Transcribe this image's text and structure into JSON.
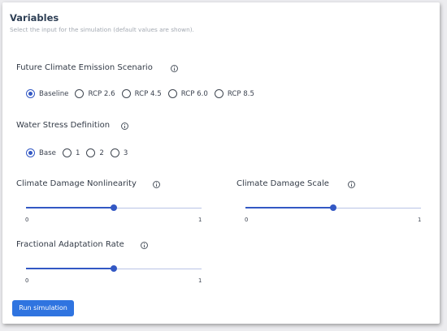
{
  "header": {
    "title": "Variables",
    "subtitle": "Select the input for the simulation (default values are shown)."
  },
  "scenario": {
    "label": "Future Climate Emission Scenario",
    "options": [
      "Baseline",
      "RCP 2.6",
      "RCP 4.5",
      "RCP 6.0",
      "RCP 8.5"
    ],
    "selected": "Baseline"
  },
  "water_stress": {
    "label": "Water Stress Definition",
    "options": [
      "Base",
      "1",
      "2",
      "3"
    ],
    "selected": "Base"
  },
  "nonlinearity": {
    "label": "Climate Damage Nonlinearity",
    "min": "0",
    "max": "1",
    "value": 0.5
  },
  "damage_scale": {
    "label": "Climate Damage Scale",
    "min": "0",
    "max": "1",
    "value": 0.5
  },
  "adaptation": {
    "label": "Fractional Adaptation Rate",
    "min": "0",
    "max": "1",
    "value": 0.5
  },
  "actions": {
    "run_label": "Run simulation"
  },
  "colors": {
    "accent": "#3358c4",
    "button": "#2f74e0",
    "title": "#2e3f55"
  },
  "icons": {
    "info": "info-circle-icon"
  }
}
